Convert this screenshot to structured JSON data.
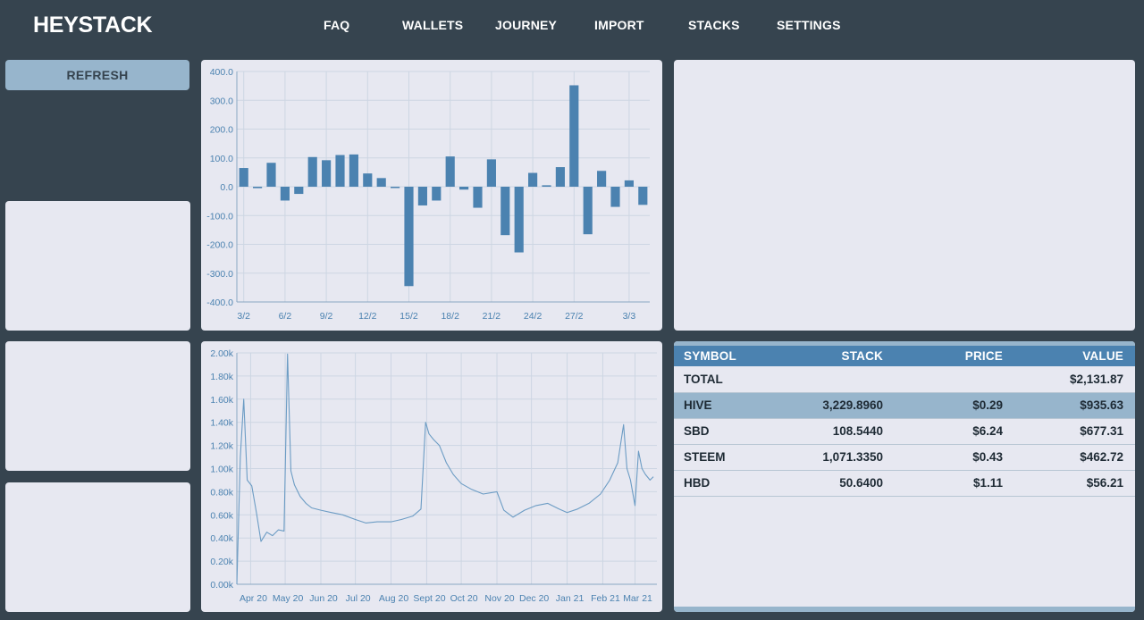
{
  "app": {
    "logo": "HEYSTACK"
  },
  "nav": {
    "items": [
      {
        "label": "FAQ"
      },
      {
        "label": "WALLETS"
      },
      {
        "label": "JOURNEY"
      },
      {
        "label": "IMPORT"
      },
      {
        "label": "STACKS"
      },
      {
        "label": "SETTINGS"
      }
    ]
  },
  "sidebar": {
    "refresh_label": "REFRESH"
  },
  "colors": {
    "background": "#36444f",
    "panel": "#e7e8f1",
    "accent": "#4b82b0",
    "highlight": "#97b5cc"
  },
  "chart_data": [
    {
      "type": "bar",
      "title": "",
      "xlabel": "",
      "ylabel": "",
      "ylim": [
        -400,
        400
      ],
      "yticks": [
        "400.0",
        "300.0",
        "200.0",
        "100.0",
        "0.0",
        "-100.0",
        "-200.0",
        "-300.0",
        "-400.0"
      ],
      "xticks": [
        "3/2",
        "6/2",
        "9/2",
        "12/2",
        "15/2",
        "18/2",
        "21/2",
        "24/2",
        "27/2",
        "3/3"
      ],
      "grid": true,
      "categories": [
        "3/2",
        "4/2",
        "5/2",
        "6/2",
        "7/2",
        "8/2",
        "9/2",
        "10/2",
        "11/2",
        "12/2",
        "13/2",
        "14/2",
        "15/2",
        "16/2",
        "17/2",
        "18/2",
        "19/2",
        "20/2",
        "21/2",
        "22/2",
        "23/2",
        "24/2",
        "25/2",
        "26/2",
        "27/2",
        "28/2",
        "1/3",
        "2/3",
        "3/3",
        "4/3"
      ],
      "values": [
        65,
        -5,
        83,
        -48,
        -25,
        103,
        92,
        110,
        112,
        46,
        30,
        0,
        -345,
        -65,
        -48,
        105,
        -10,
        -73,
        95,
        -168,
        -228,
        48,
        5,
        68,
        352,
        -165,
        55,
        -70,
        22,
        -63
      ]
    },
    {
      "type": "line",
      "title": "",
      "xlabel": "",
      "ylabel": "",
      "ylim": [
        0,
        2000
      ],
      "yticks": [
        "2.00k",
        "1.80k",
        "1.60k",
        "1.40k",
        "1.20k",
        "1.00k",
        "0.80k",
        "0.60k",
        "0.40k",
        "0.20k",
        "0.00k"
      ],
      "xticks": [
        "Apr 20",
        "May 20",
        "Jun 20",
        "Jul 20",
        "Aug 20",
        "Sept 20",
        "Oct 20",
        "Nov 20",
        "Dec 20",
        "Jan 21",
        "Feb 21",
        "Mar 21"
      ],
      "grid": true,
      "x": [
        "2020-03-20",
        "2020-03-23",
        "2020-03-26",
        "2020-03-29",
        "2020-04-02",
        "2020-04-06",
        "2020-04-10",
        "2020-04-15",
        "2020-04-20",
        "2020-04-25",
        "2020-04-30",
        "2020-05-03",
        "2020-05-06",
        "2020-05-09",
        "2020-05-14",
        "2020-05-19",
        "2020-05-24",
        "2020-06-01",
        "2020-06-10",
        "2020-06-20",
        "2020-07-01",
        "2020-07-10",
        "2020-07-20",
        "2020-08-01",
        "2020-08-10",
        "2020-08-20",
        "2020-08-27",
        "2020-08-31",
        "2020-09-03",
        "2020-09-07",
        "2020-09-12",
        "2020-09-18",
        "2020-09-24",
        "2020-10-01",
        "2020-10-10",
        "2020-10-20",
        "2020-11-01",
        "2020-11-07",
        "2020-11-15",
        "2020-11-25",
        "2020-12-05",
        "2020-12-15",
        "2020-12-25",
        "2021-01-01",
        "2021-01-10",
        "2021-01-20",
        "2021-01-30",
        "2021-02-07",
        "2021-02-14",
        "2021-02-19",
        "2021-02-22",
        "2021-02-25",
        "2021-03-01",
        "2021-03-04",
        "2021-03-07",
        "2021-03-10",
        "2021-03-14",
        "2021-03-17"
      ],
      "values": [
        0,
        1100,
        1600,
        900,
        850,
        620,
        370,
        450,
        420,
        470,
        460,
        1990,
        980,
        860,
        760,
        700,
        660,
        640,
        620,
        600,
        560,
        530,
        540,
        540,
        560,
        590,
        650,
        1400,
        1300,
        1250,
        1200,
        1050,
        950,
        870,
        820,
        780,
        800,
        640,
        580,
        640,
        680,
        700,
        650,
        620,
        650,
        700,
        780,
        900,
        1050,
        1380,
        1000,
        900,
        680,
        1150,
        1000,
        950,
        900,
        930
      ]
    }
  ],
  "table": {
    "headers": [
      "SYMBOL",
      "STACK",
      "PRICE",
      "VALUE"
    ],
    "rows": [
      {
        "symbol": "TOTAL",
        "stack": "",
        "price": "",
        "value": "$2,131.87"
      },
      {
        "symbol": "HIVE",
        "stack": "3,229.8960",
        "price": "$0.29",
        "value": "$935.63"
      },
      {
        "symbol": "SBD",
        "stack": "108.5440",
        "price": "$6.24",
        "value": "$677.31"
      },
      {
        "symbol": "STEEM",
        "stack": "1,071.3350",
        "price": "$0.43",
        "value": "$462.72"
      },
      {
        "symbol": "HBD",
        "stack": "50.6400",
        "price": "$1.11",
        "value": "$56.21"
      }
    ]
  }
}
